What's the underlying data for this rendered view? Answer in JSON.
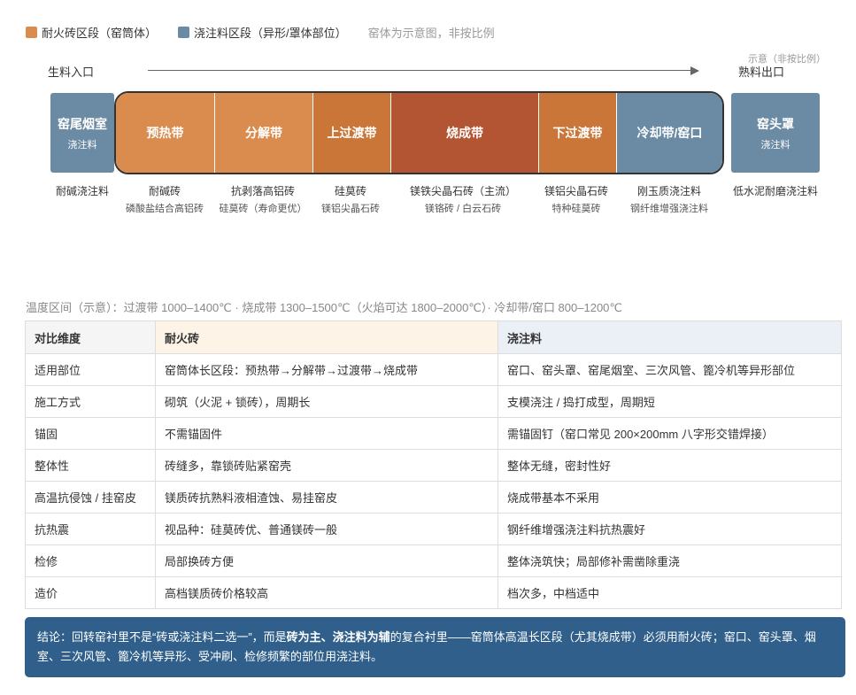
{
  "legend": {
    "items": [
      {
        "label": "耐火砖区段（窑筒体）",
        "color": "#d98c4e"
      },
      {
        "label": "浇注料区段（异形/罩体部位）",
        "color": "#6b8aa3"
      }
    ],
    "note": "窑体为示意图，非按比例"
  },
  "flow": {
    "start": "生料入口",
    "end": "熟料出口",
    "scale_note": "示意（非按比例）"
  },
  "end_blocks": {
    "left": {
      "title": "窑尾烟室",
      "subtitle": "浇注料",
      "color": "#6b8aa3"
    },
    "right": {
      "title": "窑头罩",
      "subtitle": "浇注料",
      "color": "#6b8aa3"
    }
  },
  "zones": [
    {
      "label": "预热带",
      "color": "#d98c4e"
    },
    {
      "label": "分解带",
      "color": "#d98c4e"
    },
    {
      "label": "上过渡带",
      "color": "#c97638"
    },
    {
      "label": "烧成带",
      "color": "#b35432"
    },
    {
      "label": "下过渡带",
      "color": "#c97638"
    },
    {
      "label": "冷却带/窑口",
      "color": "#6b8aa3"
    }
  ],
  "materials": [
    {
      "main": "耐碱浇注料",
      "sub": ""
    },
    {
      "main": "耐碱砖",
      "sub": "磷酸盐结合高铝砖"
    },
    {
      "main": "抗剥落高铝砖",
      "sub": "硅莫砖（寿命更优）"
    },
    {
      "main": "硅莫砖",
      "sub": "镁铝尖晶石砖"
    },
    {
      "main": "镁铁尖晶石砖（主流）",
      "sub": "镁铬砖 / 白云石砖"
    },
    {
      "main": "镁铝尖晶石砖",
      "sub": "特种硅莫砖"
    },
    {
      "main": "刚玉质浇注料",
      "sub": "钢纤维增强浇注料"
    },
    {
      "main": "低水泥耐磨浇注料",
      "sub": ""
    }
  ],
  "temperature_note": "温度区间（示意）：过渡带 1000–1400℃ · 烧成带 1300–1500℃（火焰可达 1800–2000℃）· 冷却带/窑口 800–1200℃",
  "table": {
    "headers": [
      "对比维度",
      "耐火砖",
      "浇注料"
    ],
    "rows": [
      [
        "适用部位",
        "窑筒体长区段：预热带→分解带→过渡带→烧成带",
        "窑口、窑头罩、窑尾烟室、三次风管、篦冷机等异形部位"
      ],
      [
        "施工方式",
        "砌筑（火泥 + 锁砖），周期长",
        "支模浇注 / 捣打成型，周期短"
      ],
      [
        "锚固",
        "不需锚固件",
        "需锚固钉（窑口常见 200×200mm 八字形交错焊接）"
      ],
      [
        "整体性",
        "砖缝多，靠锁砖贴紧窑壳",
        "整体无缝，密封性好"
      ],
      [
        "高温抗侵蚀 / 挂窑皮",
        "镁质砖抗熟料液相渣蚀、易挂窑皮",
        "烧成带基本不采用"
      ],
      [
        "抗热震",
        "视品种：硅莫砖优、普通镁砖一般",
        "钢纤维增强浇注料抗热震好"
      ],
      [
        "检修",
        "局部换砖方便",
        "整体浇筑快；局部修补需凿除重浇"
      ],
      [
        "造价",
        "高档镁质砖价格较高",
        "档次多，中档适中"
      ]
    ]
  },
  "conclusion": {
    "prefix": "结论：回转窑衬里不是“砖或浇注料二选一”，而是",
    "bold1": "砖为主、浇注料为辅",
    "middle": "的复合衬里——窑筒体高温长区段（尤其烧成带）必须用耐火砖；窑口、窑头罩、烟室、三次风管、篦冷机等异形、受冲刷、检修频繁的部位用浇注料。"
  }
}
